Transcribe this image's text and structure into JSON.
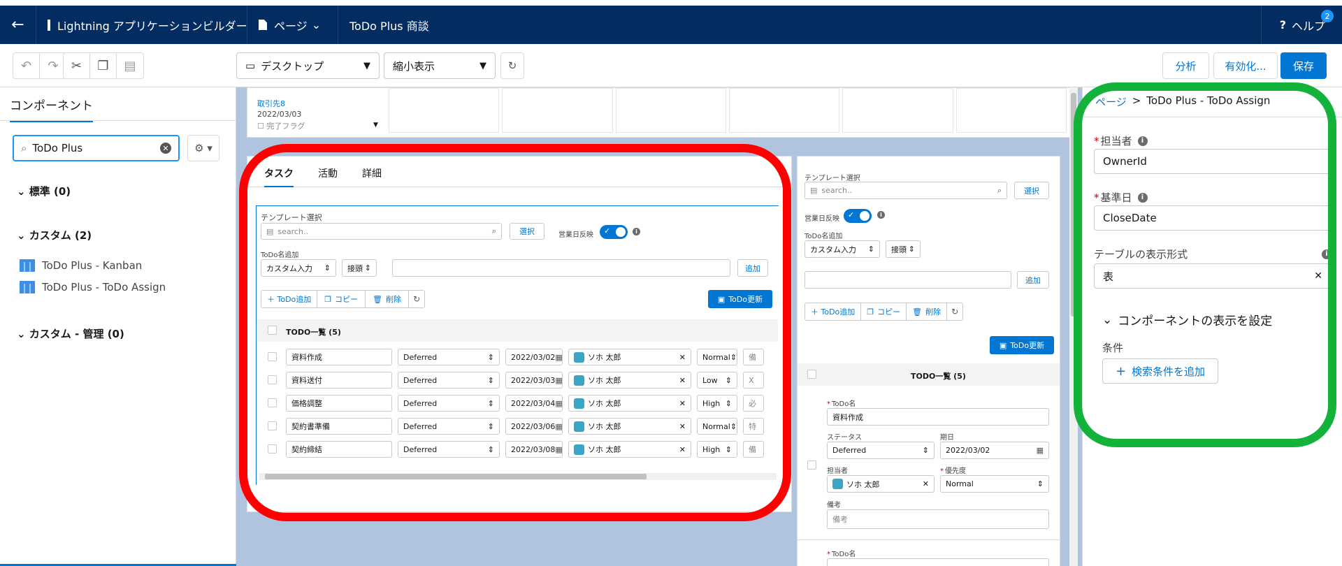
{
  "topnav": {
    "back_icon": "arrow-left-icon",
    "app_title": "Lightning アプリケーションビルダー",
    "page_menu": "ページ",
    "record_title": "ToDo Plus 商談",
    "help": "ヘルプ",
    "help_badge": "2"
  },
  "toolbar": {
    "device": "デスクトップ",
    "view": "縮小表示",
    "analyze": "分析",
    "activate": "有効化...",
    "save": "保存"
  },
  "left": {
    "tab": "コンポーネント",
    "search_value": "ToDo Plus",
    "sections": [
      {
        "label": "標準 (0)"
      },
      {
        "label": "カスタム (2)"
      },
      {
        "label": "カスタム - 管理 (0)"
      }
    ],
    "items": [
      "ToDo Plus - Kanban",
      "ToDo Plus - ToDo Assign"
    ]
  },
  "canvas": {
    "top_card": {
      "line1": "取引先8",
      "line2": "2022/03/03",
      "line3": "完了フラグ"
    },
    "tabs": [
      "タスク",
      "活動",
      "詳細"
    ],
    "left_comp": {
      "template_label": "テンプレート選択",
      "search_placeholder": "search..",
      "select": "選択",
      "bizday": "営業日反映",
      "todoname_label": "ToDo名追加",
      "custom_input": "カスタム入力",
      "suffix": "接頭",
      "add": "追加",
      "add_todo": "＋ ToDo追加",
      "copy": "コピー",
      "delete": "削除",
      "update": "ToDo更新",
      "list_title": "TODO一覧 (5)",
      "rows": [
        {
          "name": "資料作成",
          "status": "Deferred",
          "date": "2022/03/02",
          "owner": "ソホ 太郎",
          "priority": "Normal",
          "extra": "備"
        },
        {
          "name": "資料送付",
          "status": "Deferred",
          "date": "2022/03/03",
          "owner": "ソホ 太郎",
          "priority": "Low",
          "extra": "X"
        },
        {
          "name": "価格調整",
          "status": "Deferred",
          "date": "2022/03/04",
          "owner": "ソホ 太郎",
          "priority": "High",
          "extra": "必"
        },
        {
          "name": "契約書準備",
          "status": "Deferred",
          "date": "2022/03/06",
          "owner": "ソホ 太郎",
          "priority": "Normal",
          "extra": "特"
        },
        {
          "name": "契約締結",
          "status": "Deferred",
          "date": "2022/03/08",
          "owner": "ソホ 太郎",
          "priority": "High",
          "extra": "備"
        }
      ]
    },
    "right_comp": {
      "template_label": "テンプレート選択",
      "search_placeholder": "search..",
      "select": "選択",
      "bizday": "営業日反映",
      "todoname_label": "ToDo名追加",
      "custom_input": "カスタム入力",
      "suffix": "接頭",
      "add": "追加",
      "add_todo": "＋ ToDo追加",
      "copy": "コピー",
      "delete": "削除",
      "update": "ToDo更新",
      "list_title": "TODO一覧 (5)",
      "form": {
        "name_label": "ToDo名",
        "name_value": "資料作成",
        "status_label": "ステータス",
        "status_value": "Deferred",
        "date_label": "期日",
        "date_value": "2022/03/02",
        "owner_label": "担当者",
        "owner_value": "ソホ 太郎",
        "priority_label": "優先度",
        "priority_value": "Normal",
        "memo_label": "備考",
        "memo_placeholder": "備考",
        "name_label2": "ToDo名"
      }
    }
  },
  "right": {
    "breadcrumb_page": "ページ",
    "breadcrumb_sep": ">",
    "breadcrumb_current": "ToDo Plus - ToDo Assign",
    "owner_label": "担当者",
    "owner_value": "OwnerId",
    "base_date_label": "基準日",
    "base_date_value": "CloseDate",
    "table_label": "テーブルの表示形式",
    "table_value": "表",
    "visibility_title": "コンポーネントの表示を設定",
    "condition_label": "条件",
    "add_condition": "検索条件を追加"
  },
  "colors": {
    "nav": "#032d60",
    "brand": "#0176d3",
    "annotation_red": "#ff0000",
    "annotation_green": "#13b23a"
  }
}
